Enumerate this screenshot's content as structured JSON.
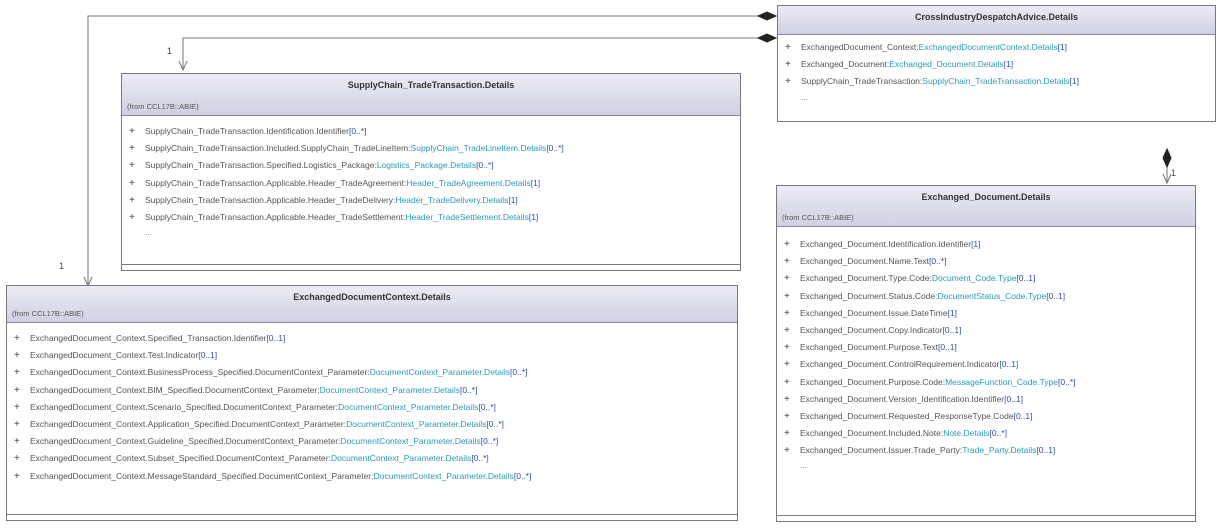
{
  "classes": {
    "cida": {
      "title": "CrossIndustryDespatchAdvice.Details",
      "from": "",
      "rows": [
        {
          "name": "ExchangedDocument_Context:",
          "type": "ExchangedDocumentContext.Details",
          "mult": "[1]"
        },
        {
          "name": "Exchanged_Document:",
          "type": "Exchanged_Document.Details",
          "mult": "[1]"
        },
        {
          "name": "SupplyChain_TradeTransaction:",
          "type": "SupplyChain_TradeTransaction.Details",
          "mult": "[1]"
        }
      ],
      "ellipsis": "..."
    },
    "sctt": {
      "title": "SupplyChain_TradeTransaction.Details",
      "from": "(from CCL17B::ABIE)",
      "rows": [
        {
          "name": "SupplyChain_TradeTransaction.Identification.Identifier",
          "type": "",
          "mult": "[0..*]"
        },
        {
          "name": "SupplyChain_TradeTransaction.Included.SupplyChain_TradeLineItem:",
          "type": "SupplyChain_TradeLineItem.Details",
          "mult": "[0..*]"
        },
        {
          "name": "SupplyChain_TradeTransaction.Specified.Logistics_Package:",
          "type": "Logistics_Package.Details",
          "mult": "[0..*]"
        },
        {
          "name": "SupplyChain_TradeTransaction.Applicable.Header_TradeAgreement:",
          "type": "Header_TradeAgreement.Details",
          "mult": "[1]"
        },
        {
          "name": "SupplyChain_TradeTransaction.Applicable.Header_TradeDelivery:",
          "type": "Header_TradeDelivery.Details",
          "mult": "[1]"
        },
        {
          "name": "SupplyChain_TradeTransaction.Applicable.Header_TradeSettlement:",
          "type": "Header_TradeSettlement.Details",
          "mult": "[1]"
        }
      ],
      "ellipsis": "..."
    },
    "edc": {
      "title": "ExchangedDocumentContext.Details",
      "from": "(from CCL17B::ABIE)",
      "rows": [
        {
          "name": "ExchangedDocument_Context.Specified_Transaction.Identifier",
          "type": "",
          "mult": "[0..1]"
        },
        {
          "name": "ExchangedDocument_Context.Test.Indicator",
          "type": "",
          "mult": "[0..1]"
        },
        {
          "name": "ExchangedDocument_Context.BusinessProcess_Specified.DocumentContext_Parameter:",
          "type": "DocumentContext_Parameter.Details",
          "mult": "[0..*]"
        },
        {
          "name": "ExchangedDocument_Context.BIM_Specified.DocumentContext_Parameter:",
          "type": "DocumentContext_Parameter.Details",
          "mult": "[0..*]"
        },
        {
          "name": "ExchangedDocument_Context.Scenario_Specified.DocumentContext_Parameter:",
          "type": "DocumentContext_Parameter.Details",
          "mult": "[0..*]"
        },
        {
          "name": "ExchangedDocument_Context.Application_Specified.DocumentContext_Parameter:",
          "type": "DocumentContext_Parameter.Details",
          "mult": "[0..*]"
        },
        {
          "name": "ExchangedDocument_Context.Guideline_Specified.DocumentContext_Parameter:",
          "type": "DocumentContext_Parameter.Details",
          "mult": "[0..*]"
        },
        {
          "name": "ExchangedDocument_Context.Subset_Specified.DocumentContext_Parameter:",
          "type": "DocumentContext_Parameter.Details",
          "mult": "[0..*]"
        },
        {
          "name": "ExchangedDocument_Context.MessageStandard_Specified.DocumentContext_Parameter:",
          "type": "DocumentContext_Parameter.Details",
          "mult": "[0..*]"
        }
      ],
      "ellipsis": ""
    },
    "ed": {
      "title": "Exchanged_Document.Details",
      "from": "(from CCL17B::ABIE)",
      "rows": [
        {
          "name": "Exchanged_Document.Identification.Identifier",
          "type": "",
          "mult": "[1]"
        },
        {
          "name": "Exchanged_Document.Name.Text",
          "type": "",
          "mult": "[0..*]"
        },
        {
          "name": "Exchanged_Document.Type.Code:",
          "type": "Document_Code.Type",
          "mult": "[0..1]"
        },
        {
          "name": "Exchanged_Document.Status.Code:",
          "type": "DocumentStatus_Code.Type",
          "mult": "[0..1]"
        },
        {
          "name": "Exchanged_Document.Issue.DateTime",
          "type": "",
          "mult": "[1]"
        },
        {
          "name": "Exchanged_Document.Copy.Indicator",
          "type": "",
          "mult": "[0..1]"
        },
        {
          "name": "Exchanged_Document.Purpose.Text",
          "type": "",
          "mult": "[0..1]"
        },
        {
          "name": "Exchanged_Document.ControlRequirement.Indicator",
          "type": "",
          "mult": "[0..1]"
        },
        {
          "name": "Exchanged_Document.Purpose.Code:",
          "type": "MessageFunction_Code.Type",
          "mult": "[0..*]"
        },
        {
          "name": "Exchanged_Document.Version_Identification.Identifier",
          "type": "",
          "mult": "[0..1]"
        },
        {
          "name": "Exchanged_Document.Requested_ResponseType.Code",
          "type": "",
          "mult": "[0..1]"
        },
        {
          "name": "Exchanged_Document.Included.Note:",
          "type": "Note.Details",
          "mult": "[0..*]"
        },
        {
          "name": "Exchanged_Document.Issuer.Trade_Party:",
          "type": "Trade_Party.Details",
          "mult": "[0..1]"
        }
      ],
      "ellipsis": "..."
    }
  },
  "multiplicities": {
    "sctt_end": "1",
    "edc_end": "1",
    "ed_end": "1"
  }
}
